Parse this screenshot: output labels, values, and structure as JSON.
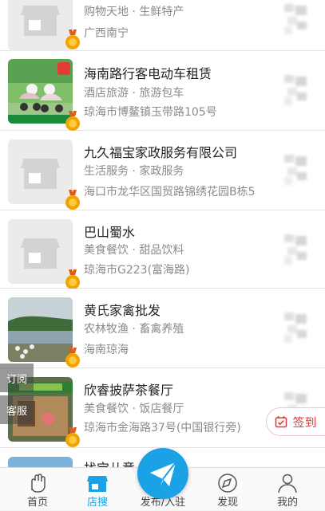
{
  "listings": [
    {
      "title": "",
      "category": "购物天地 · 生鲜特产",
      "address": "广西南宁",
      "thumb": "shop-placeholder"
    },
    {
      "title": "海南路行客电动车租赁",
      "category": "酒店旅游 · 旅游包车",
      "address": "琼海市博鳌镇玉带路105号",
      "thumb": "scooter-photo"
    },
    {
      "title": "九久福宝家政服务有限公司",
      "category": "生活服务 · 家政服务",
      "address": "海口市龙华区国贸路锦绣花园B栋5",
      "thumb": "shop-placeholder"
    },
    {
      "title": "巴山蜀水",
      "category": "美食餐饮 · 甜品饮料",
      "address": "琼海市G223(富海路)",
      "thumb": "shop-placeholder"
    },
    {
      "title": "黄氏家禽批发",
      "category": "农林牧渔 · 畜禽养殖",
      "address": "海南琼海",
      "thumb": "poultry-photo"
    },
    {
      "title": "欣睿披萨茶餐厅",
      "category": "美食餐饮 · 饭店餐厅",
      "address": "琼海市金海路37号(中国银行旁)",
      "thumb": "restaurant-photo"
    }
  ],
  "partial_title": "找宝儿童…",
  "side_tabs": {
    "subscribe": "订阅",
    "service": "客服"
  },
  "signin_label": "签到",
  "tabbar": [
    {
      "label": "首页",
      "icon": "hand-icon",
      "active": false
    },
    {
      "label": "店搜",
      "icon": "store-icon",
      "active": true
    },
    {
      "label": "发布/入驻",
      "icon": "paper-plane-icon",
      "active": false
    },
    {
      "label": "发现",
      "icon": "compass-icon",
      "active": false
    },
    {
      "label": "我的",
      "icon": "person-icon",
      "active": false
    }
  ],
  "colors": {
    "accent": "#1aa1e6",
    "signin": "#e23b3b",
    "medal": "#f0a400"
  }
}
